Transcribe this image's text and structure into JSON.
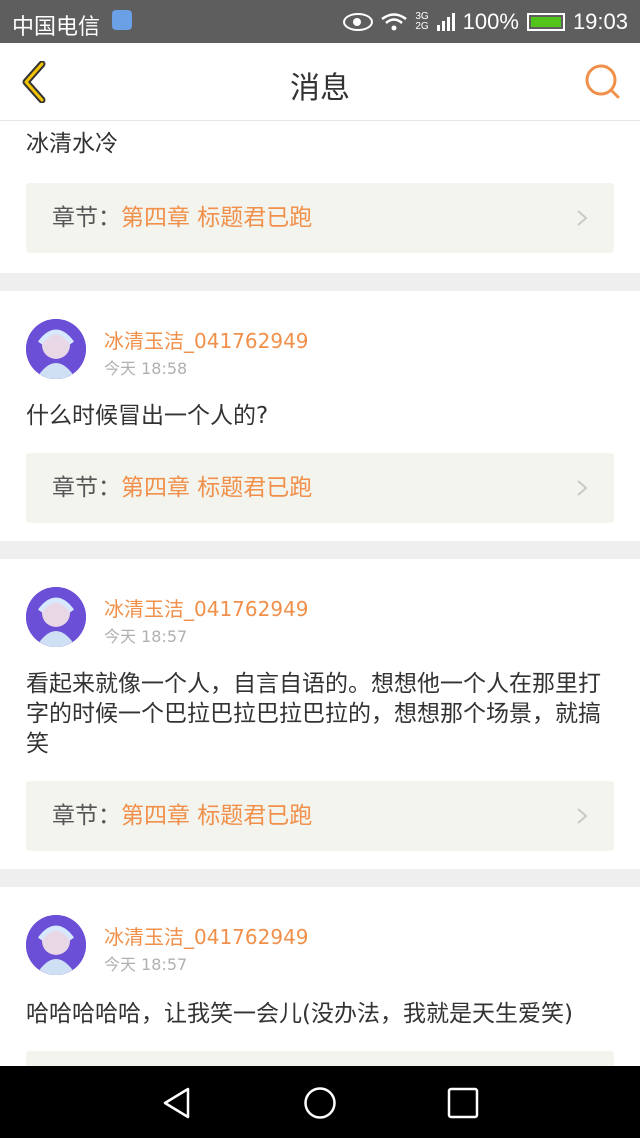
{
  "status_bar": {
    "carrier": "中国电信",
    "network_3g": "3G",
    "network_2g": "2G",
    "battery_percent": "100%",
    "time": "19:03"
  },
  "header": {
    "title": "消息",
    "icons": {
      "back": "chevron-left-icon",
      "search": "search-icon"
    }
  },
  "colors": {
    "accent": "#f0904a",
    "chapter_bg": "#f4f4ef",
    "page_bg": "#efefef"
  },
  "messages": [
    {
      "text": "冰清水冷",
      "chapter_label": "章节：",
      "chapter_value": "第四章   标题君已跑"
    },
    {
      "user": "冰清玉洁_041762949",
      "time": "今天 18:58",
      "text": "什么时候冒出一个人的?",
      "chapter_label": "章节：",
      "chapter_value": "第四章   标题君已跑"
    },
    {
      "user": "冰清玉洁_041762949",
      "time": "今天 18:57",
      "text": "看起来就像一个人，自言自语的。想想他一个人在那里打字的时候一个巴拉巴拉巴拉巴拉的，想想那个场景，就搞笑",
      "chapter_label": "章节：",
      "chapter_value": "第四章   标题君已跑"
    },
    {
      "user": "冰清玉洁_041762949",
      "time": "今天 18:57",
      "text": "哈哈哈哈哈，让我笑一会儿(没办法，我就是天生爱笑)"
    }
  ],
  "nav_bar": {
    "icons": [
      "back-triangle-icon",
      "home-circle-icon",
      "recents-square-icon"
    ]
  }
}
